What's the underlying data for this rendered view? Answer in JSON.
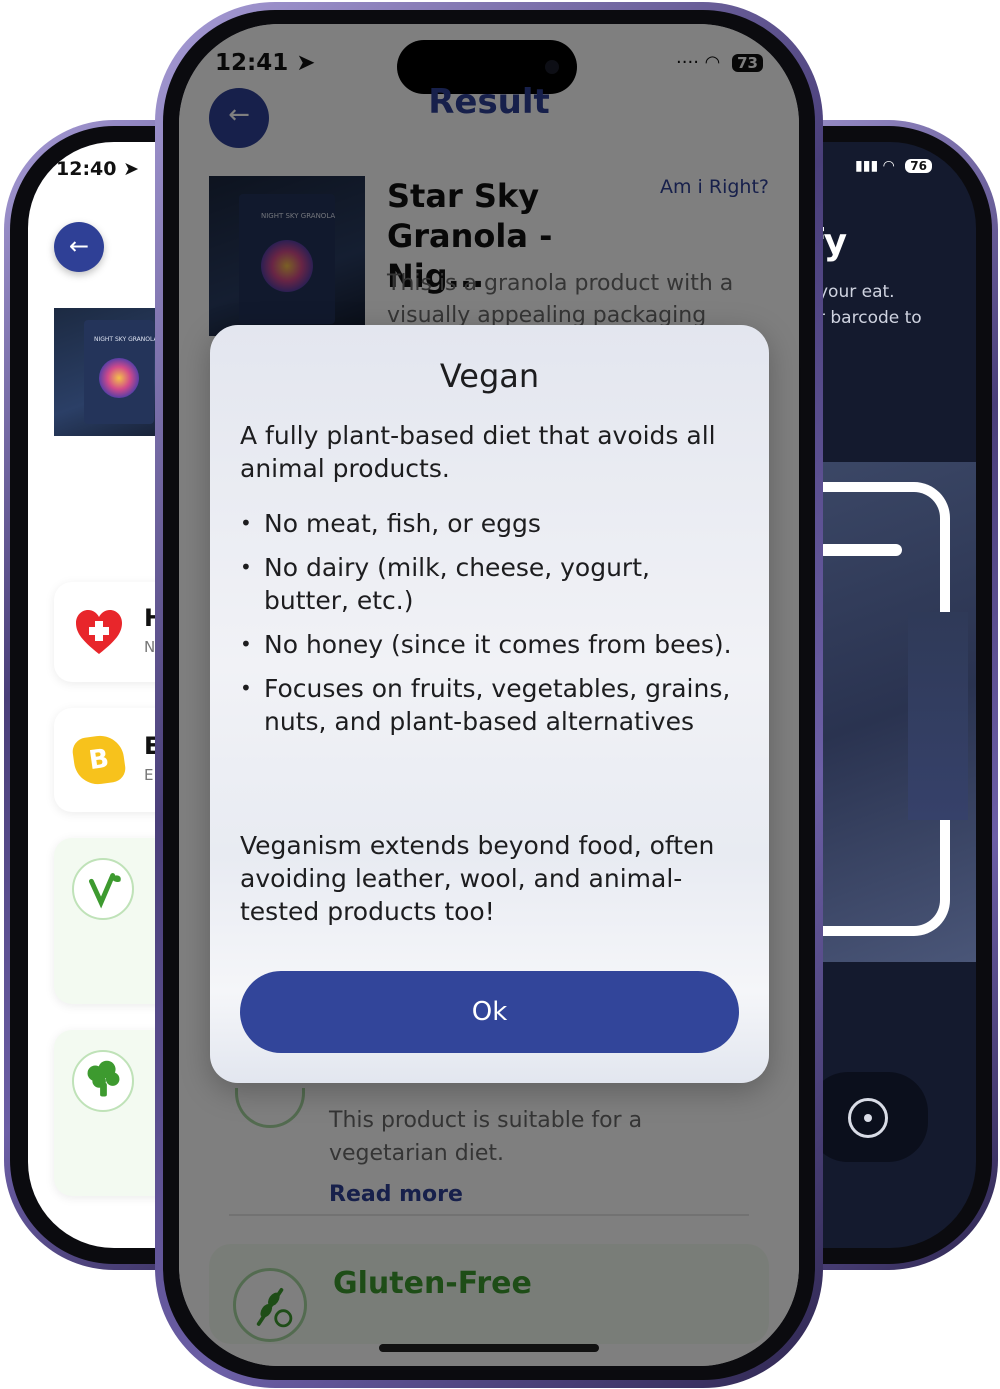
{
  "left_phone": {
    "time": "12:40",
    "back_icon": "arrow-left-icon",
    "product_image_text": "NIGHT SKY GRANOLA",
    "cards": [
      {
        "letter": "H",
        "sub": "N",
        "icon": "heart-plus-icon"
      },
      {
        "letter": "E",
        "sub": "E",
        "icon": "nutri-b-icon",
        "badge": "B"
      },
      {
        "icon": "vegan-leaf-icon"
      },
      {
        "icon": "broccoli-icon"
      }
    ]
  },
  "right_phone": {
    "battery": "76",
    "title_fragment": "fy",
    "text_line_1": "your eat.",
    "text_line_2": "r barcode to",
    "flip_icon": "camera-flip-icon"
  },
  "center_phone": {
    "time": "12:41",
    "battery": "73",
    "header": "Result",
    "back_icon": "arrow-left-icon",
    "product": {
      "name": "Star Sky Granola - Nig...",
      "image_text": "NIGHT SKY GRANOLA",
      "am_i_right": "Am i Right?",
      "description": "This is a granola product with a visually appealing packaging"
    },
    "vegetarian_card": {
      "description": "This product is suitable for a vegetarian diet.",
      "read_more": "Read more"
    },
    "gluten_free_card": {
      "title": "Gluten-Free",
      "icon": "gluten-free-icon"
    }
  },
  "modal": {
    "title": "Vegan",
    "intro": "A fully plant-based diet that avoids all animal products.",
    "bullets": [
      "No meat, fish, or eggs",
      "No dairy (milk, cheese, yogurt, butter, etc.)",
      "No honey (since it comes from bees).",
      "Focuses on fruits, vegetables, grains, nuts, and plant-based alternatives"
    ],
    "outro": "Veganism extends beyond food, often avoiding leather, wool, and animal-tested products too!",
    "ok_label": "Ok"
  },
  "colors": {
    "brand_blue": "#2f4096",
    "ok_button": "#32459a",
    "green_accent": "#3d9a2f",
    "phone_frame": "#6c5fa6"
  }
}
